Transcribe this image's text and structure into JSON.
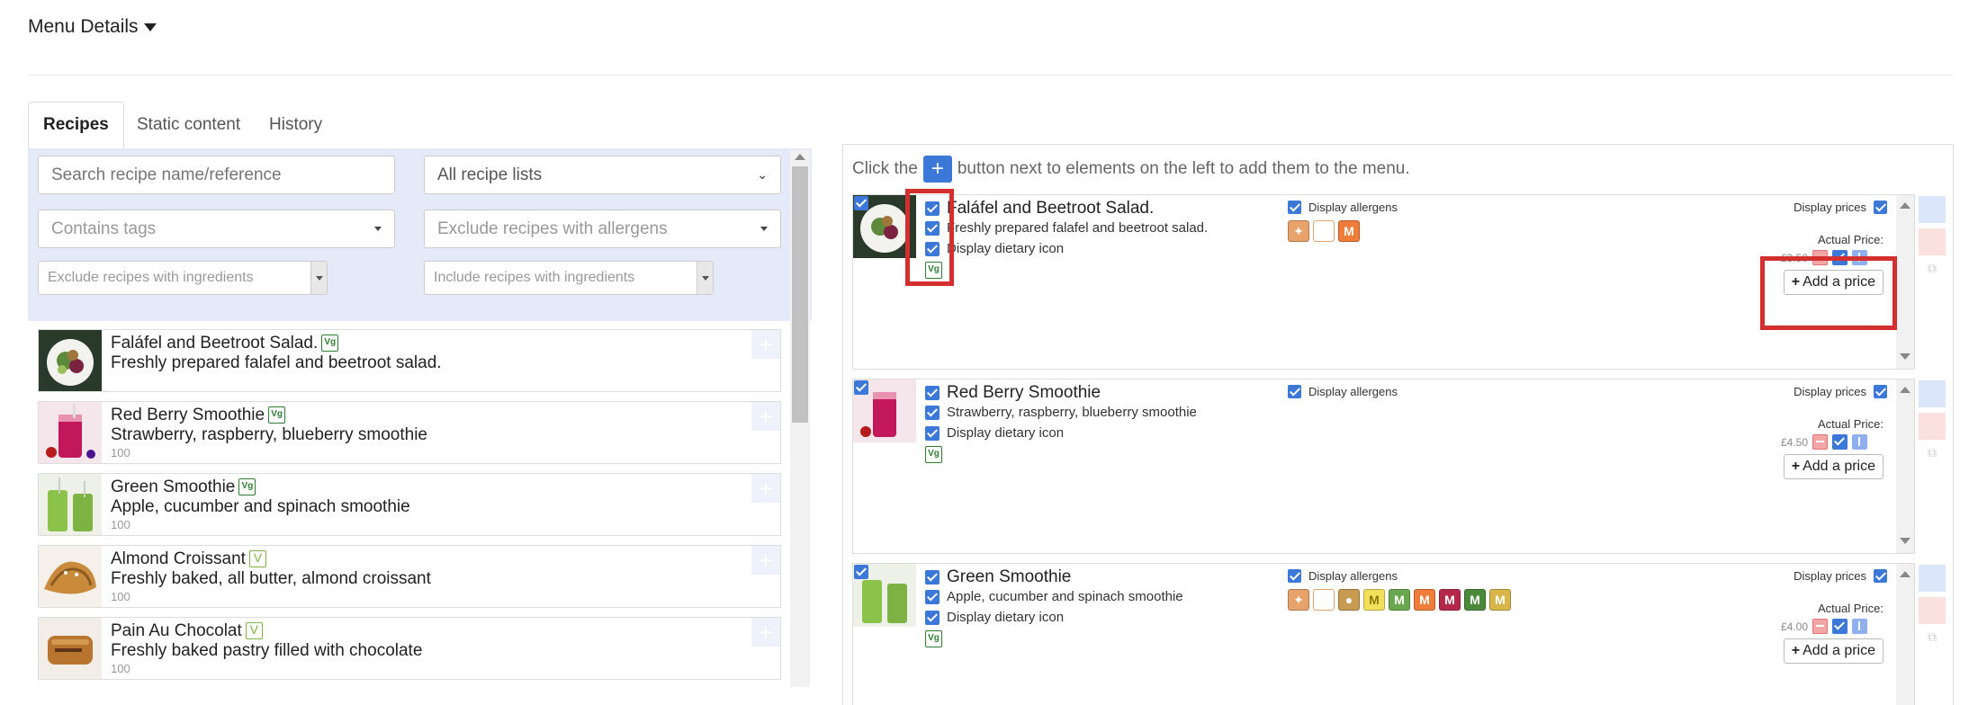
{
  "header": {
    "title": "Menu Details"
  },
  "tabs": [
    {
      "label": "Recipes"
    },
    {
      "label": "Static content"
    },
    {
      "label": "History"
    }
  ],
  "filters": {
    "search_placeholder": "Search recipe name/reference",
    "recipe_lists": "All recipe lists",
    "contains_tags": "Contains tags",
    "exclude_allergens": "Exclude recipes with allergens",
    "exclude_ingredients": "Exclude recipes with ingredients",
    "include_ingredients": "Include recipes with ingredients"
  },
  "recipes": [
    {
      "name": "Faláfel and Beetroot Salad.",
      "desc": "Freshly prepared falafel and beetroot salad.",
      "code": "",
      "diet": "vegan"
    },
    {
      "name": "Red Berry Smoothie",
      "desc": "Strawberry, raspberry, blueberry smoothie",
      "code": "100",
      "diet": "vegan"
    },
    {
      "name": "Green Smoothie",
      "desc": "Apple, cucumber and spinach smoothie",
      "code": "100",
      "diet": "vegan"
    },
    {
      "name": "Almond Croissant",
      "desc": "Freshly baked, all butter, almond croissant",
      "code": "100",
      "diet": "vegetarian"
    },
    {
      "name": "Pain Au Chocolat",
      "desc": "Freshly baked pastry filled with chocolate",
      "code": "100",
      "diet": "vegetarian"
    }
  ],
  "menu": {
    "instruction_before": "Click the",
    "instruction_after": "button next to elements on the left to add them to the menu.",
    "display_allergens": "Display allergens",
    "display_prices": "Display prices",
    "actual_price": "Actual Price:",
    "add_price": "Add a price",
    "display_dietary_icon": "Display dietary icon",
    "items": [
      {
        "name": "Faláfel and Beetroot Salad.",
        "desc": "Freshly prepared falafel and beetroot salad.",
        "price": "£3.50",
        "allergens": [
          "#e8a26a",
          "#ffffff",
          "#f07c3a"
        ]
      },
      {
        "name": "Red Berry Smoothie",
        "desc": "Strawberry, raspberry, blueberry smoothie",
        "price": "£4.50",
        "allergens": []
      },
      {
        "name": "Green Smoothie",
        "desc": "Apple, cucumber and spinach smoothie",
        "price": "£4.00",
        "allergens": [
          "#e8a26a",
          "#ffffff",
          "#c89a52",
          "#f3e05a",
          "#6aa84f",
          "#f07c3a",
          "#b4284a",
          "#4a8a3a",
          "#d8b64a"
        ]
      }
    ]
  },
  "icons": {
    "plus": "+",
    "vegan": "Vg",
    "vegetarian": "V",
    "milk": "M"
  },
  "colors": {
    "accent": "#3c78d8",
    "filter_bg": "#e5eaf8",
    "annotation": "#d32f2f"
  }
}
